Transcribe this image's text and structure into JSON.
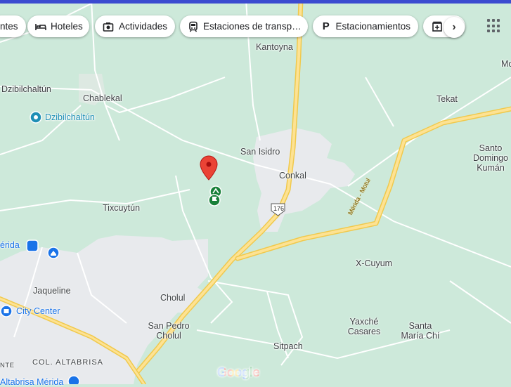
{
  "filters": [
    {
      "label": "ntes",
      "icon": "none"
    },
    {
      "label": "Hoteles",
      "icon": "bed-icon"
    },
    {
      "label": "Actividades",
      "icon": "camera-icon"
    },
    {
      "label": "Estaciones de transp…",
      "icon": "train-icon"
    },
    {
      "label": "Estacionamientos",
      "icon": "parking-icon"
    },
    {
      "label": "",
      "icon": "pharmacy-icon"
    }
  ],
  "places": {
    "kantoyna": "Kantoyna",
    "dzibilchaltun_town": "Dzibilchaltún",
    "chablekal": "Chablekal",
    "dzibilchaltun_poi": "Dzibilchaltún",
    "tekat": "Tekat",
    "mo": "Mo",
    "san_isidro": "San Isidro",
    "conkal": "Conkal",
    "santo_domingo_1": "Santo",
    "santo_domingo_2": "Domingo",
    "santo_domingo_3": "Kumán",
    "tixcuytun": "Tixcuytún",
    "merida": "érida",
    "x_cuyum": "X-Cuyum",
    "jaqueline": "Jaqueline",
    "city_center": "City Center",
    "cholul": "Cholul",
    "san_pedro_cholul_1": "San Pedro",
    "san_pedro_cholul_2": "Cholul",
    "yaxche_1": "Yaxché",
    "yaxche_2": "Casares",
    "santa_maria_1": "Santa",
    "santa_maria_2": "María Chí",
    "sitpach": "Sitpach",
    "col_altabrisa": "COL. ALTABRISA",
    "nte": "NTE",
    "altabrisa_merida": "Altabrisa Mérida"
  },
  "roads": {
    "hwy_shield": "176",
    "merida_motul": "Mérida - Motul"
  },
  "branding": {
    "google": "Google"
  },
  "colors": {
    "land": "#cde9da",
    "urban": "#e8eaed",
    "highway": "#fde293",
    "highway_edge": "#f0c94c",
    "road": "#ffffff",
    "pin": "#ea4335",
    "poi_green": "#188038",
    "poi_blue": "#1a73e8"
  }
}
